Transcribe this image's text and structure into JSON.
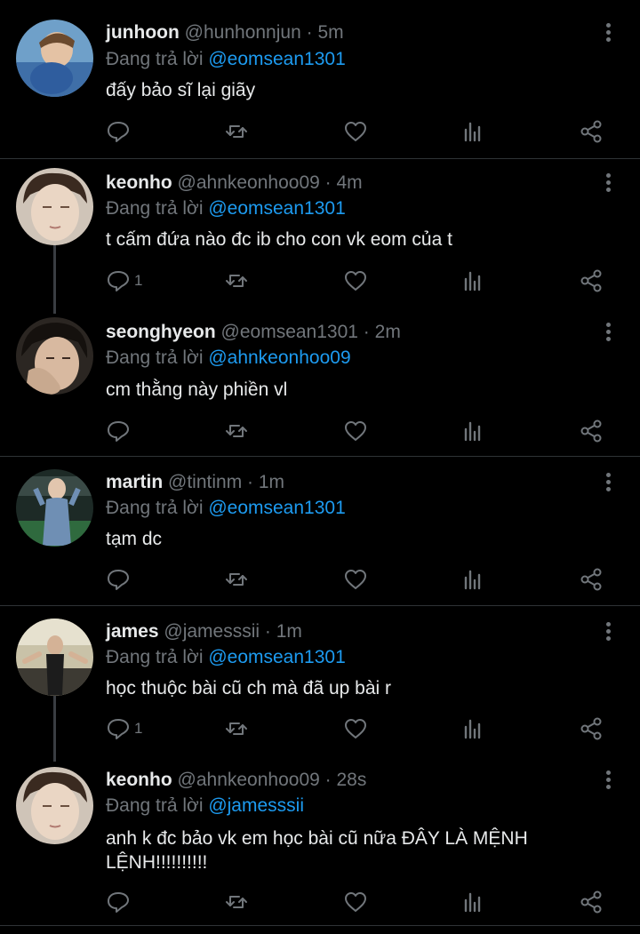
{
  "reply_prefix": "Đang trả lời",
  "tweets": [
    {
      "name": "junhoon",
      "handle": "@hunhonnjun",
      "time": "5m",
      "reply_to": "@eomsean1301",
      "text": "đấy bảo sĩ lại giãy",
      "reply_count": ""
    },
    {
      "name": "keonho",
      "handle": "@ahnkeonhoo09",
      "time": "4m",
      "reply_to": "@eomsean1301",
      "text": "t cấm đứa nào đc ib cho con vk eom của t",
      "reply_count": "1"
    },
    {
      "name": "seonghyeon",
      "handle": "@eomsean1301",
      "time": "2m",
      "reply_to": "@ahnkeonhoo09",
      "text": "cm thằng này phiền vl",
      "reply_count": ""
    },
    {
      "name": "martin",
      "handle": "@tintinm",
      "time": "1m",
      "reply_to": "@eomsean1301",
      "text": "tạm dc",
      "reply_count": ""
    },
    {
      "name": "james",
      "handle": "@jamesssii",
      "time": "1m",
      "reply_to": "@eomsean1301",
      "text": "học thuộc bài cũ ch mà đã up bài r",
      "reply_count": "1"
    },
    {
      "name": "keonho",
      "handle": "@ahnkeonhoo09",
      "time": "28s",
      "reply_to": "@jamesssii",
      "text": "anh k đc bảo vk em học bài cũ nữa ĐÂY LÀ MỆNH LỆNH!!!!!!!!!!",
      "reply_count": ""
    }
  ],
  "icons": {
    "reply": "reply-icon",
    "retweet": "retweet-icon",
    "like": "heart-icon",
    "views": "analytics-icon",
    "share": "share-icon",
    "more": "more-vertical-icon"
  },
  "colors": {
    "background": "#000000",
    "text": "#e7e9ea",
    "secondary": "#71767b",
    "mention": "#1d9bf0",
    "divider": "#2f3336"
  }
}
